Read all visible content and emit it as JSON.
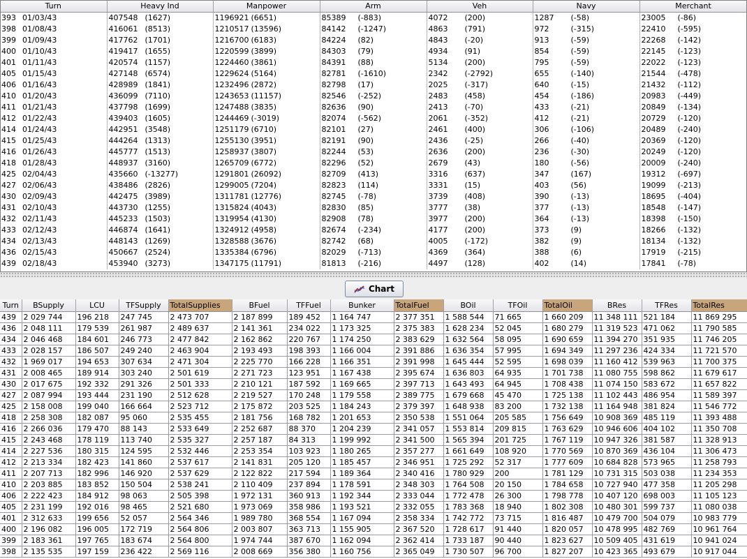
{
  "top_table": {
    "columns": [
      "Turn",
      "Heavy Ind",
      "Manpower",
      "Arm",
      "Veh",
      "Navy",
      "Merchant"
    ],
    "rows": [
      [
        "393",
        "01/03/43",
        "407548",
        "(1627)",
        "1196921",
        "(6651)",
        "85389",
        "(-883)",
        "4072",
        "(200)",
        "1287",
        "(-58)",
        "23005",
        "(-86)"
      ],
      [
        "398",
        "01/08/43",
        "416061",
        "(8513)",
        "1210517",
        "(13596)",
        "84142",
        "(-1247)",
        "4863",
        "(791)",
        "972",
        "(-315)",
        "22410",
        "(-595)"
      ],
      [
        "399",
        "01/09/43",
        "417762",
        "(1701)",
        "1216700",
        "(6183)",
        "84224",
        "(82)",
        "4843",
        "(-20)",
        "913",
        "(-59)",
        "22268",
        "(-142)"
      ],
      [
        "400",
        "01/10/43",
        "419417",
        "(1655)",
        "1220599",
        "(3899)",
        "84303",
        "(79)",
        "4934",
        "(91)",
        "854",
        "(-59)",
        "22145",
        "(-123)"
      ],
      [
        "401",
        "01/11/43",
        "420574",
        "(1157)",
        "1224460",
        "(3861)",
        "84391",
        "(88)",
        "5134",
        "(200)",
        "795",
        "(-59)",
        "22022",
        "(-123)"
      ],
      [
        "405",
        "01/15/43",
        "427148",
        "(6574)",
        "1229624",
        "(5164)",
        "82781",
        "(-1610)",
        "2342",
        "(-2792)",
        "655",
        "(-140)",
        "21544",
        "(-478)"
      ],
      [
        "406",
        "01/16/43",
        "428989",
        "(1841)",
        "1232496",
        "(2872)",
        "82798",
        "(17)",
        "2025",
        "(-317)",
        "640",
        "(-15)",
        "21432",
        "(-112)"
      ],
      [
        "410",
        "01/20/43",
        "436099",
        "(7110)",
        "1243653",
        "(11157)",
        "82546",
        "(-252)",
        "2483",
        "(458)",
        "454",
        "(-186)",
        "20983",
        "(-449)"
      ],
      [
        "411",
        "01/21/43",
        "437798",
        "(1699)",
        "1247488",
        "(3835)",
        "82636",
        "(90)",
        "2413",
        "(-70)",
        "433",
        "(-21)",
        "20849",
        "(-134)"
      ],
      [
        "412",
        "01/22/43",
        "439403",
        "(1605)",
        "1244469",
        "(-3019)",
        "82074",
        "(-562)",
        "2061",
        "(-352)",
        "412",
        "(-21)",
        "20729",
        "(-120)"
      ],
      [
        "414",
        "01/24/43",
        "442951",
        "(3548)",
        "1251179",
        "(6710)",
        "82101",
        "(27)",
        "2461",
        "(400)",
        "306",
        "(-106)",
        "20489",
        "(-240)"
      ],
      [
        "415",
        "01/25/43",
        "444264",
        "(1313)",
        "1255130",
        "(3951)",
        "82191",
        "(90)",
        "2436",
        "(-25)",
        "266",
        "(-40)",
        "20369",
        "(-120)"
      ],
      [
        "416",
        "01/26/43",
        "445777",
        "(1513)",
        "1258937",
        "(3807)",
        "82244",
        "(53)",
        "2636",
        "(200)",
        "236",
        "(-30)",
        "20249",
        "(-120)"
      ],
      [
        "418",
        "01/28/43",
        "448937",
        "(3160)",
        "1265709",
        "(6772)",
        "82296",
        "(52)",
        "2679",
        "(43)",
        "180",
        "(-56)",
        "20009",
        "(-240)"
      ],
      [
        "425",
        "02/04/43",
        "435660",
        "(-13277)",
        "1291801",
        "(26092)",
        "82709",
        "(413)",
        "3316",
        "(637)",
        "347",
        "(167)",
        "19312",
        "(-697)"
      ],
      [
        "427",
        "02/06/43",
        "438486",
        "(2826)",
        "1299005",
        "(7204)",
        "82823",
        "(114)",
        "3331",
        "(15)",
        "403",
        "(56)",
        "19099",
        "(-213)"
      ],
      [
        "430",
        "02/09/43",
        "442475",
        "(3989)",
        "1311781",
        "(12776)",
        "82745",
        "(-78)",
        "3739",
        "(408)",
        "390",
        "(-13)",
        "18695",
        "(-404)"
      ],
      [
        "431",
        "02/10/43",
        "443730",
        "(1255)",
        "1315824",
        "(4043)",
        "82830",
        "(85)",
        "3777",
        "(38)",
        "377",
        "(-13)",
        "18548",
        "(-147)"
      ],
      [
        "432",
        "02/11/43",
        "445233",
        "(1503)",
        "1319954",
        "(4130)",
        "82908",
        "(78)",
        "3977",
        "(200)",
        "364",
        "(-13)",
        "18398",
        "(-150)"
      ],
      [
        "433",
        "02/12/43",
        "446874",
        "(1641)",
        "1324912",
        "(4958)",
        "82674",
        "(-234)",
        "4177",
        "(200)",
        "373",
        "(9)",
        "18266",
        "(-132)"
      ],
      [
        "434",
        "02/13/43",
        "448143",
        "(1269)",
        "1328588",
        "(3676)",
        "82742",
        "(68)",
        "4005",
        "(-172)",
        "382",
        "(9)",
        "18134",
        "(-132)"
      ],
      [
        "436",
        "02/15/43",
        "450667",
        "(2524)",
        "1335384",
        "(6796)",
        "82029",
        "(-713)",
        "4369",
        "(364)",
        "388",
        "(6)",
        "17919",
        "(-215)"
      ],
      [
        "439",
        "02/18/43",
        "453940",
        "(3273)",
        "1347175",
        "(11791)",
        "81813",
        "(-216)",
        "4497",
        "(128)",
        "402",
        "(14)",
        "17841",
        "(-78)"
      ]
    ]
  },
  "chart_button": {
    "label": "Chart",
    "icon": "chart-line-icon"
  },
  "bottom_table": {
    "highlight_color": "#c8a57a",
    "columns": [
      "Turn",
      "BSupply",
      "LCU",
      "TFSupply",
      "TotalSupplies",
      "BFuel",
      "TFFuel",
      "Bunker",
      "TotalFuel",
      "BOil",
      "TFOil",
      "TotalOil",
      "BRes",
      "TFRes",
      "TotalRes"
    ],
    "highlighted_columns": [
      "TotalSupplies",
      "TotalFuel",
      "TotalOil",
      "TotalRes"
    ],
    "rows": [
      [
        "439",
        "2 029 744",
        "196 218",
        "247 745",
        "2 473 707",
        "2 187 899",
        "189 452",
        "1 164 747",
        "2 377 351",
        "1 588 544",
        "71 665",
        "1 660 209",
        "11 348 111",
        "521 184",
        "11 869 295"
      ],
      [
        "436",
        "2 048 111",
        "179 539",
        "261 987",
        "2 489 637",
        "2 141 361",
        "234 022",
        "1 173 325",
        "2 375 383",
        "1 628 234",
        "52 045",
        "1 680 279",
        "11 319 523",
        "471 062",
        "11 790 585"
      ],
      [
        "434",
        "2 046 468",
        "184 601",
        "246 773",
        "2 477 842",
        "2 162 862",
        "220 767",
        "1 174 250",
        "2 383 629",
        "1 632 564",
        "58 095",
        "1 690 659",
        "11 394 270",
        "351 935",
        "11 746 205"
      ],
      [
        "433",
        "2 028 157",
        "186 507",
        "249 240",
        "2 463 904",
        "2 193 493",
        "198 393",
        "1 166 004",
        "2 391 886",
        "1 636 354",
        "57 995",
        "1 694 349",
        "11 297 236",
        "424 334",
        "11 721 570"
      ],
      [
        "432",
        "1 969 017",
        "194 653",
        "307 634",
        "2 471 304",
        "2 225 770",
        "166 228",
        "1 166 351",
        "2 391 998",
        "1 645 444",
        "52 595",
        "1 698 039",
        "11 160 412",
        "539 963",
        "11 700 375"
      ],
      [
        "431",
        "2 008 465",
        "189 914",
        "303 240",
        "2 501 619",
        "2 271 723",
        "123 951",
        "1 167 438",
        "2 395 674",
        "1 636 803",
        "64 935",
        "1 701 738",
        "11 080 755",
        "598 862",
        "11 679 617"
      ],
      [
        "430",
        "2 017 675",
        "192 332",
        "291 326",
        "2 501 333",
        "2 210 121",
        "187 592",
        "1 169 665",
        "2 397 713",
        "1 643 493",
        "64 945",
        "1 708 438",
        "11 074 150",
        "583 672",
        "11 657 822"
      ],
      [
        "427",
        "2 087 994",
        "193 444",
        "231 190",
        "2 512 628",
        "2 219 527",
        "170 248",
        "1 179 558",
        "2 389 775",
        "1 679 668",
        "45 470",
        "1 725 138",
        "11 102 443",
        "486 954",
        "11 589 397"
      ],
      [
        "425",
        "2 158 008",
        "199 040",
        "166 664",
        "2 523 712",
        "2 175 872",
        "203 525",
        "1 184 243",
        "2 379 397",
        "1 648 938",
        "83 200",
        "1 732 138",
        "11 164 948",
        "381 824",
        "11 546 772"
      ],
      [
        "418",
        "2 258 308",
        "182 087",
        "95 060",
        "2 535 455",
        "2 181 756",
        "168 782",
        "1 201 653",
        "2 350 538",
        "1 551 064",
        "205 585",
        "1 756 649",
        "10 908 369",
        "485 119",
        "11 393 488"
      ],
      [
        "416",
        "2 266 036",
        "179 470",
        "88 143",
        "2 533 649",
        "2 252 687",
        "88 370",
        "1 204 239",
        "2 341 057",
        "1 553 814",
        "209 815",
        "1 763 629",
        "10 946 606",
        "404 102",
        "11 350 708"
      ],
      [
        "415",
        "2 243 468",
        "178 119",
        "113 740",
        "2 535 327",
        "2 257 187",
        "84 313",
        "1 199 992",
        "2 341 500",
        "1 565 394",
        "201 725",
        "1 767 119",
        "10 947 326",
        "381 587",
        "11 328 913"
      ],
      [
        "414",
        "2 227 536",
        "180 315",
        "124 595",
        "2 532 446",
        "2 253 354",
        "103 923",
        "1 180 265",
        "2 357 277",
        "1 661 649",
        "108 920",
        "1 770 569",
        "10 870 369",
        "436 104",
        "11 306 473"
      ],
      [
        "412",
        "2 213 334",
        "182 423",
        "141 860",
        "2 537 617",
        "2 141 831",
        "205 120",
        "1 185 457",
        "2 346 951",
        "1 725 292",
        "52 317",
        "1 777 609",
        "10 684 828",
        "573 965",
        "11 258 793"
      ],
      [
        "411",
        "2 207 713",
        "182 996",
        "146 920",
        "2 537 629",
        "2 122 822",
        "217 594",
        "1 189 364",
        "2 340 416",
        "1 780 929",
        "200",
        "1 781 129",
        "10 731 315",
        "503 038",
        "11 234 353"
      ],
      [
        "410",
        "2 203 885",
        "183 852",
        "150 504",
        "2 538 241",
        "2 110 409",
        "237 894",
        "1 178 591",
        "2 348 303",
        "1 764 508",
        "20 150",
        "1 784 658",
        "10 727 940",
        "477 358",
        "11 205 298"
      ],
      [
        "406",
        "2 222 423",
        "184 912",
        "98 063",
        "2 505 398",
        "1 972 131",
        "360 913",
        "1 192 344",
        "2 333 044",
        "1 772 478",
        "26 300",
        "1 798 778",
        "10 407 120",
        "698 003",
        "11 105 123"
      ],
      [
        "405",
        "2 231 199",
        "192 016",
        "98 465",
        "2 521 680",
        "1 973 069",
        "358 986",
        "1 193 521",
        "2 332 055",
        "1 783 368",
        "18 940",
        "1 802 308",
        "10 480 301",
        "599 737",
        "11 080 038"
      ],
      [
        "401",
        "2 312 633",
        "199 656",
        "52 057",
        "2 564 346",
        "1 989 780",
        "368 554",
        "1 167 094",
        "2 358 334",
        "1 742 772",
        "73 715",
        "1 816 487",
        "10 479 700",
        "504 079",
        "10 983 779"
      ],
      [
        "400",
        "2 196 082",
        "196 005",
        "172 719",
        "2 564 806",
        "2 003 807",
        "363 713",
        "1 155 905",
        "2 367 520",
        "1 728 617",
        "91 440",
        "1 820 057",
        "10 478 995",
        "482 769",
        "10 961 764"
      ],
      [
        "399",
        "2 183 361",
        "197 765",
        "183 674",
        "2 564 800",
        "1 974 744",
        "387 670",
        "1 162 094",
        "2 362 414",
        "1 733 187",
        "90 440",
        "1 823 627",
        "10 509 405",
        "431 619",
        "10 941 024"
      ],
      [
        "398",
        "2 135 535",
        "197 159",
        "236 422",
        "2 569 116",
        "2 008 669",
        "356 380",
        "1 160 756",
        "2 365 049",
        "1 730 507",
        "96 700",
        "1 827 207",
        "10 423 365",
        "493 679",
        "10 917 044"
      ]
    ]
  }
}
